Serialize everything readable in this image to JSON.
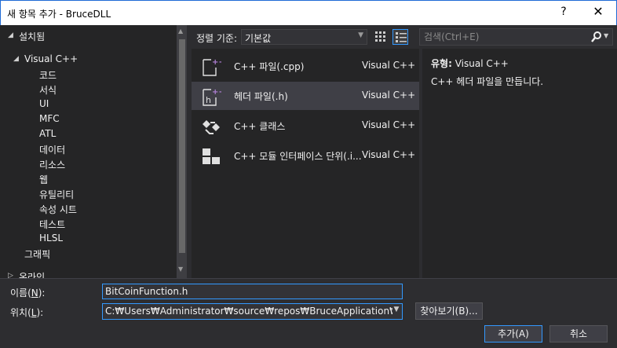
{
  "window": {
    "title": "새 항목 추가 - BruceDLL",
    "help": "?",
    "close": "✕"
  },
  "tree": {
    "installed": "설치됨",
    "root": "Visual C++",
    "children": [
      "코드",
      "서식",
      "UI",
      "MFC",
      "ATL",
      "데이터",
      "리소스",
      "웹",
      "유틸리티",
      "속성 시트",
      "테스트",
      "HLSL"
    ],
    "graphics": "그래픽",
    "online": "온라인"
  },
  "toolbar": {
    "sort_label": "정렬 기준:",
    "sort_value": "기본값",
    "search_placeholder": "검색(Ctrl+E)"
  },
  "templates": [
    {
      "name": "C++ 파일(.cpp)",
      "lang": "Visual C++",
      "icon": "cpp-file-icon"
    },
    {
      "name": "헤더 파일(.h)",
      "lang": "Visual C++",
      "icon": "header-file-icon"
    },
    {
      "name": "C++ 클래스",
      "lang": "Visual C++",
      "icon": "cpp-class-icon"
    },
    {
      "name": "C++ 모듈 인터페이스 단위(.i...",
      "lang": "Visual C++",
      "icon": "module-icon"
    }
  ],
  "detail": {
    "type_label": "유형:",
    "type_value": "Visual C++",
    "description": "C++ 헤더 파일을 만듭니다."
  },
  "form": {
    "name_label_pre": "이름(",
    "name_label_key": "N",
    "name_label_post": "):",
    "name_value": "BitCoinFunction.h",
    "loc_label_pre": "위치(",
    "loc_label_key": "L",
    "loc_label_post": "):",
    "loc_value": "C:₩Users₩Administrator₩source₩repos₩BruceApplication₩BruceDLL₩",
    "browse_label": "찾아보기(B)...",
    "add_label": "추가(A)",
    "cancel_label": "취소"
  },
  "colors": {
    "background": "#2d2d30",
    "panel": "#252526",
    "selection": "#3f3f46",
    "accent": "#3399ff",
    "icon_purple": "#b180d7"
  }
}
